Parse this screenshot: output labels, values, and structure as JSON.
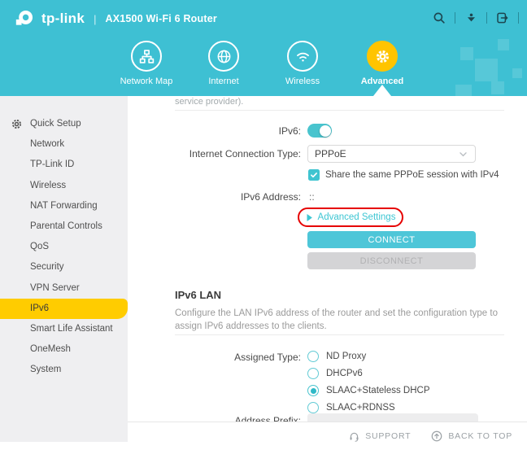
{
  "colors": {
    "header_teal": "#3ec0d3",
    "accent_yellow": "#ffc400",
    "sidebar_active_yellow": "#ffcc00",
    "link_teal": "#3dc6d3",
    "connect_button_teal": "#4ec6d8",
    "annotation_red": "#e60000"
  },
  "icons": {
    "search": "magnifier",
    "firmware_update": "dot-over-down-arrow",
    "logout": "box-with-right-arrow",
    "network_map": "sitemap",
    "internet": "globe",
    "wireless": "wifi-arcs",
    "advanced": "gear",
    "quick_setup": "nut-gear",
    "support": "headset",
    "back_to_top": "up-arrow-circle",
    "advanced_settings_link": "play-triangle"
  },
  "header": {
    "brand": "tp-link",
    "separator": "|",
    "device_title": "AX1500 Wi-Fi 6 Router"
  },
  "nav": {
    "tabs": [
      {
        "label": "Network Map",
        "active": false
      },
      {
        "label": "Internet",
        "active": false
      },
      {
        "label": "Wireless",
        "active": false
      },
      {
        "label": "Advanced",
        "active": true
      }
    ]
  },
  "sidebar": {
    "items": [
      {
        "label": "Quick Setup",
        "active": false
      },
      {
        "label": "Network",
        "active": false
      },
      {
        "label": "TP-Link ID",
        "active": false
      },
      {
        "label": "Wireless",
        "active": false
      },
      {
        "label": "NAT Forwarding",
        "active": false
      },
      {
        "label": "Parental Controls",
        "active": false
      },
      {
        "label": "QoS",
        "active": false
      },
      {
        "label": "Security",
        "active": false
      },
      {
        "label": "VPN Server",
        "active": false
      },
      {
        "label": "IPv6",
        "active": true
      },
      {
        "label": "Smart Life Assistant",
        "active": false
      },
      {
        "label": "OneMesh",
        "active": false
      },
      {
        "label": "System",
        "active": false
      }
    ]
  },
  "main": {
    "partial_top_text": "service provider).",
    "ipv6_toggle": {
      "label": "IPv6:",
      "state": "on"
    },
    "connection_type": {
      "label": "Internet Connection Type:",
      "value": "PPPoE"
    },
    "share_session": {
      "label": "Share the same PPPoE session with IPv4",
      "checked": true
    },
    "ipv6_address": {
      "label": "IPv6 Address:",
      "value": "::"
    },
    "advanced_settings": {
      "label": "Advanced Settings"
    },
    "buttons": {
      "connect": "CONNECT",
      "disconnect": "DISCONNECT"
    },
    "ipv6_lan": {
      "title": "IPv6 LAN",
      "description": "Configure the LAN IPv6 address of the router and set the configuration type to assign IPv6 addresses to the clients."
    },
    "assigned_type": {
      "label": "Assigned Type:",
      "options": [
        {
          "label": "ND Proxy",
          "selected": false
        },
        {
          "label": "DHCPv6",
          "selected": false
        },
        {
          "label": "SLAAC+Stateless DHCP",
          "selected": true
        },
        {
          "label": "SLAAC+RDNSS",
          "selected": false
        }
      ]
    },
    "address_prefix": {
      "label": "Address Prefix:"
    }
  },
  "footer": {
    "support": "SUPPORT",
    "back_to_top": "BACK TO TOP"
  }
}
